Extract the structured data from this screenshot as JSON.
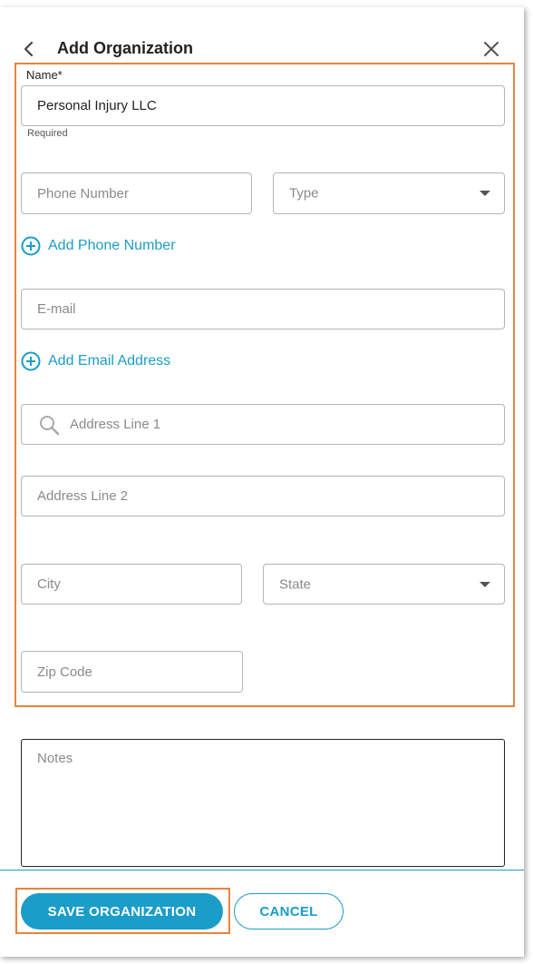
{
  "header": {
    "title": "Add Organization",
    "back_icon": "chevron-left-icon",
    "close_icon": "close-icon"
  },
  "form": {
    "name": {
      "label": "Name*",
      "value": "Personal Injury LLC",
      "helper": "Required"
    },
    "phone": {
      "placeholder": "Phone Number",
      "type_placeholder": "Type",
      "add_label": "Add Phone Number"
    },
    "email": {
      "placeholder": "E-mail",
      "add_label": "Add Email Address"
    },
    "address": {
      "line1_placeholder": "Address Line 1",
      "line2_placeholder": "Address Line 2",
      "city_placeholder": "City",
      "state_placeholder": "State",
      "zip_placeholder": "Zip Code"
    },
    "notes": {
      "placeholder": "Notes"
    }
  },
  "footer": {
    "save_label": "SAVE ORGANIZATION",
    "cancel_label": "CANCEL"
  },
  "colors": {
    "accent": "#1a9dc9",
    "highlight": "#e8843c",
    "border": "#b5b5b5"
  }
}
